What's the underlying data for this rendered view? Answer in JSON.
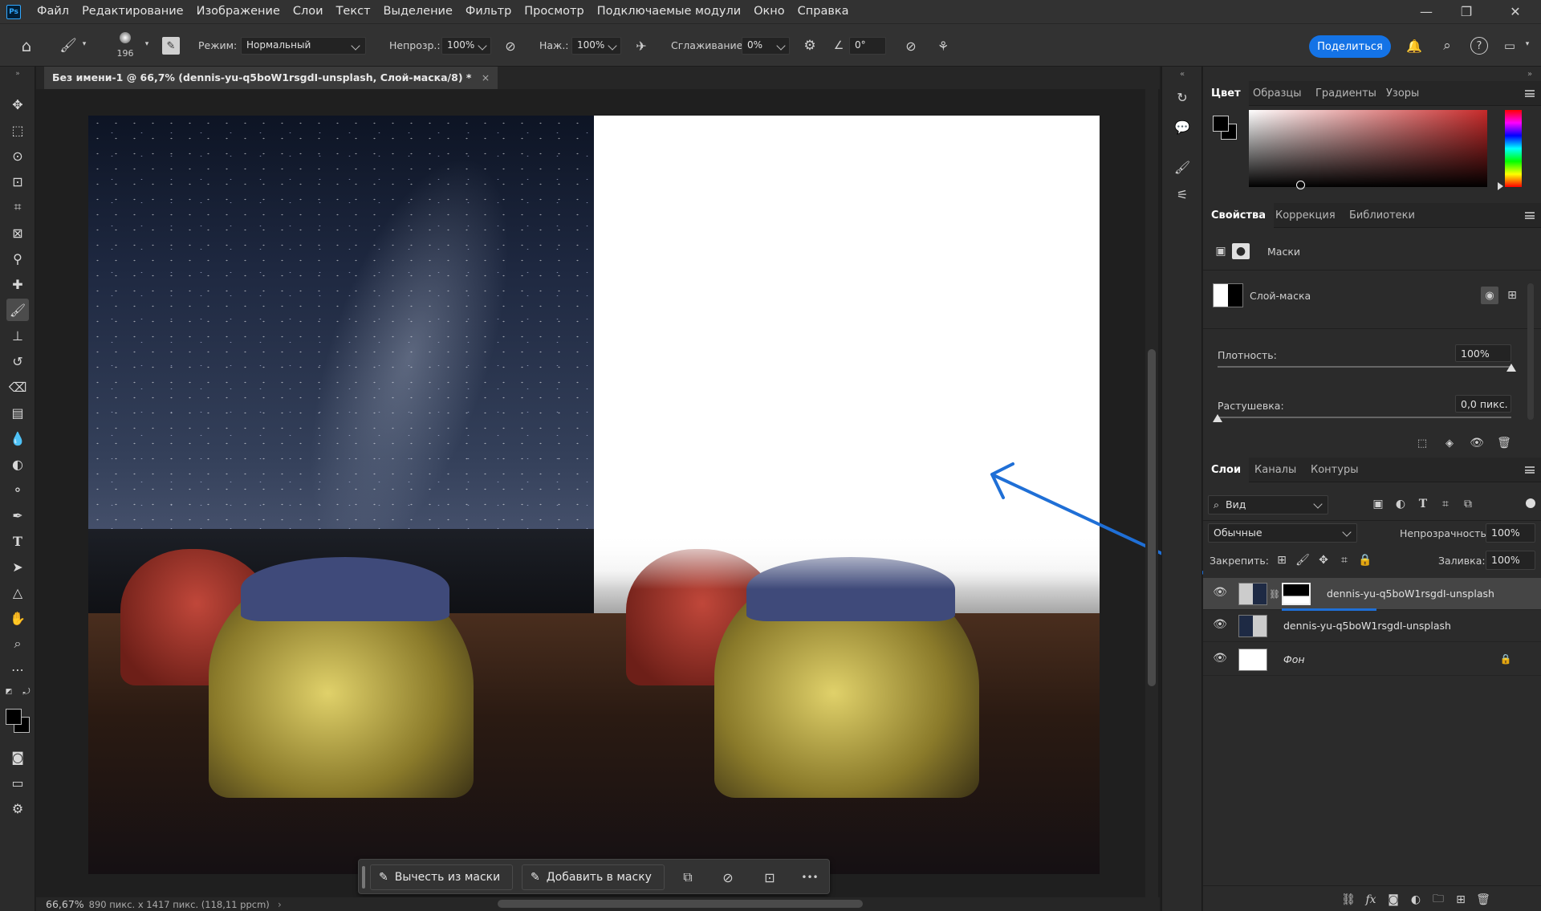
{
  "menu": {
    "app_logo": "Ps",
    "items": [
      "Файл",
      "Редактирование",
      "Изображение",
      "Слои",
      "Текст",
      "Выделение",
      "Фильтр",
      "Просмотр",
      "Подключаемые модули",
      "Окно",
      "Справка"
    ]
  },
  "options": {
    "brush_size": "196",
    "mode_label": "Режим:",
    "mode_value": "Нормальный",
    "opacity_label": "Непрозр.:",
    "opacity_value": "100%",
    "pressure_label": "Наж.:",
    "pressure_value": "100%",
    "smoothing_label": "Сглаживание:",
    "smoothing_value": "0%",
    "angle_value": "0°",
    "share_label": "Поделиться"
  },
  "document": {
    "tab_title": "Без имени-1 @ 66,7% (dennis-yu-q5boW1rsgdI-unsplash, Слой-маска/8) *",
    "close": "×"
  },
  "mask_bar": {
    "subtract_label": "Вычесть из маски",
    "add_label": "Добавить в маску",
    "more": "•••"
  },
  "status": {
    "zoom": "66,67%",
    "info": "890 пикс. x 1417 пикс. (118,11 ppcm)"
  },
  "color_panel": {
    "tabs": [
      "Цвет",
      "Образцы",
      "Градиенты",
      "Узоры"
    ]
  },
  "properties_panel": {
    "tabs": [
      "Свойства",
      "Коррекция",
      "Библиотеки"
    ],
    "section_label": "Маски",
    "mask_label": "Слой-маска",
    "density_label": "Плотность:",
    "density_value": "100%",
    "density_level": 1.0,
    "feather_label": "Растушевка:",
    "feather_value": "0,0 пикс.",
    "feather_level": 0.0
  },
  "layers_panel": {
    "tabs": [
      "Слои",
      "Каналы",
      "Контуры"
    ],
    "filter_label": "Вид",
    "blend_mode": "Обычные",
    "opacity_label": "Непрозрачность:",
    "opacity_value": "100%",
    "lock_label": "Закрепить:",
    "fill_label": "Заливка:",
    "fill_value": "100%",
    "layers": [
      {
        "name": "dennis-yu-q5boW1rsgdI-unsplash",
        "selected": true
      },
      {
        "name": "dennis-yu-q5boW1rsgdI-unsplash",
        "selected": false
      },
      {
        "name": "Фон",
        "selected": false
      }
    ]
  },
  "colors": {
    "accent": "#1473e6",
    "annotation_arrow": "#1f6fd6",
    "panel_bg": "#2b2b2b",
    "menubar_bg": "#323232"
  }
}
